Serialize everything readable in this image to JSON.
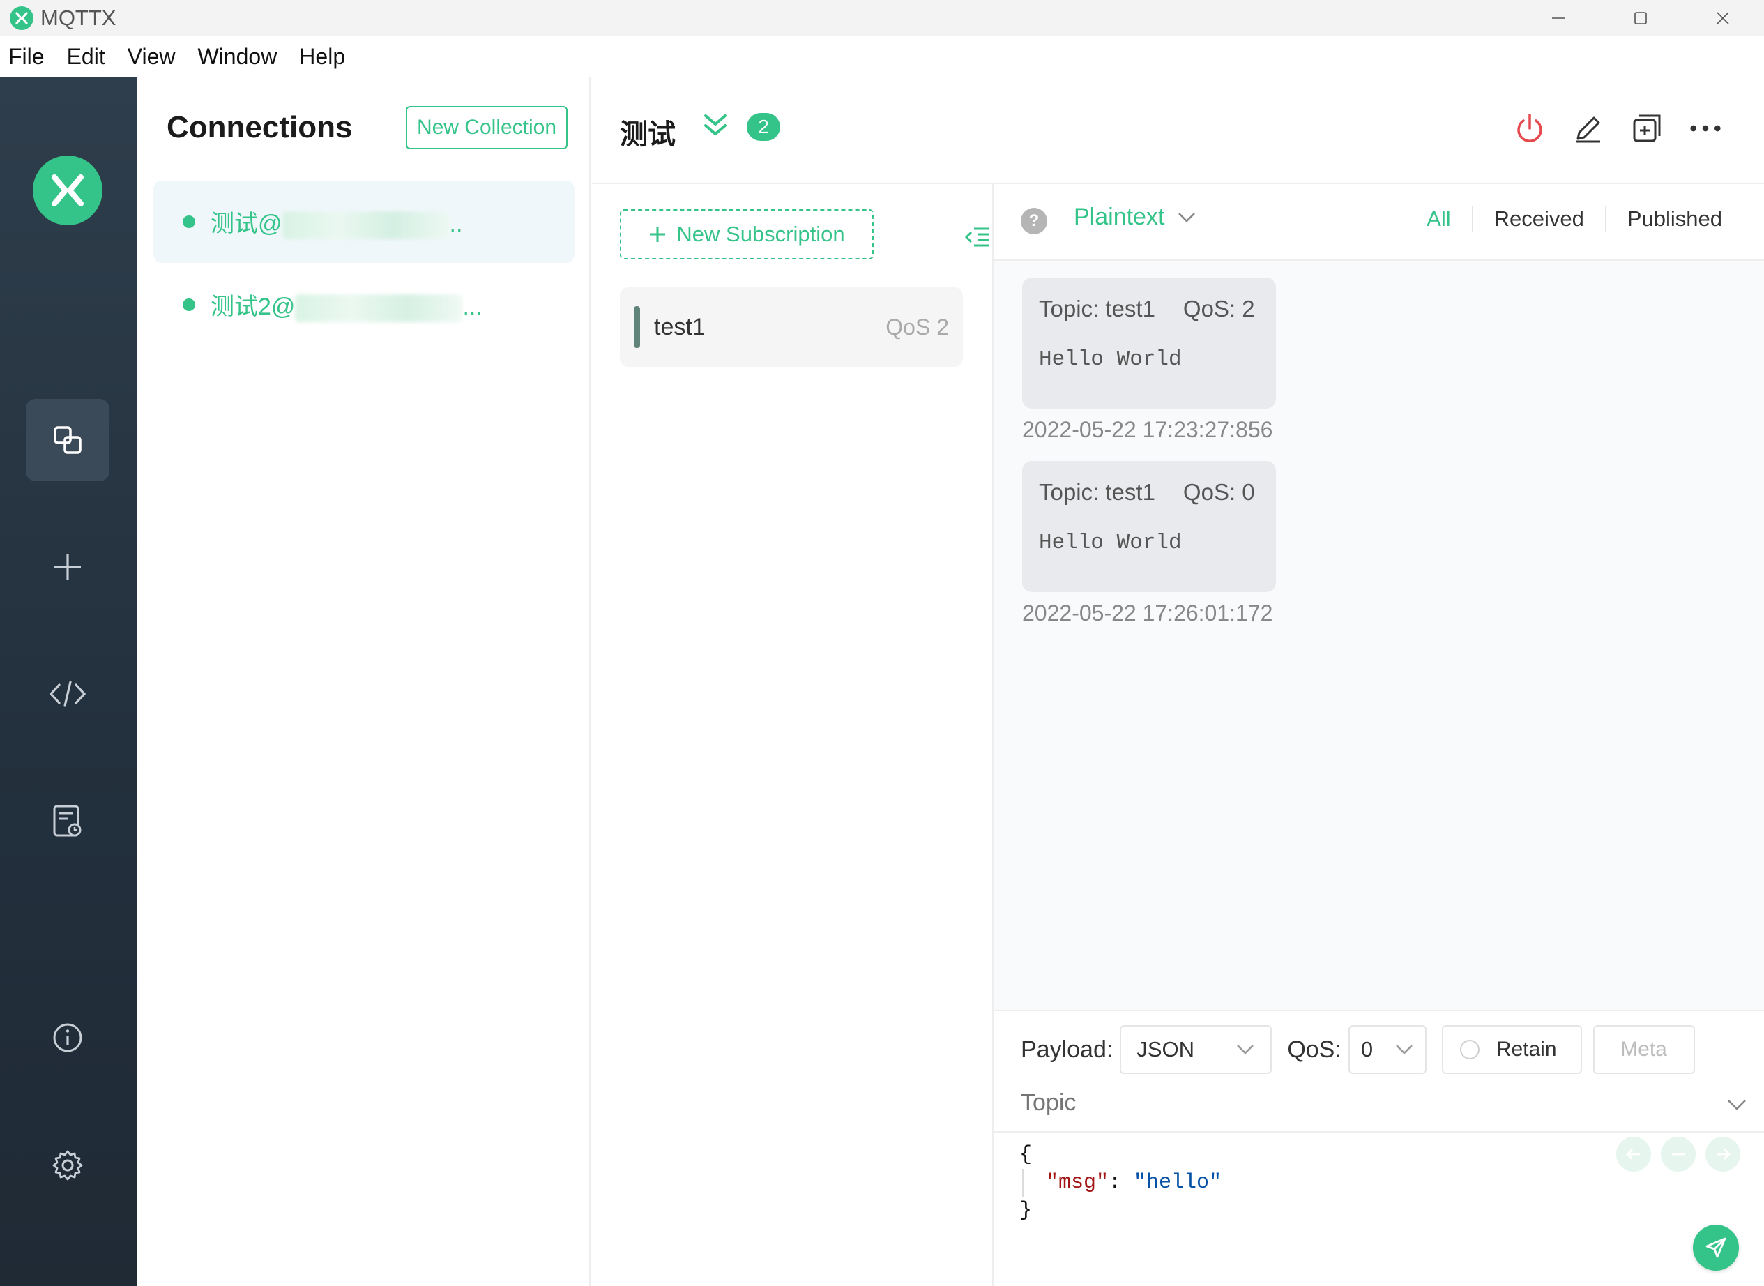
{
  "window": {
    "app_title": "MQTTX"
  },
  "menu": [
    "File",
    "Edit",
    "View",
    "Window",
    "Help"
  ],
  "connections_panel": {
    "title": "Connections",
    "new_collection_label": "New Collection",
    "items": [
      {
        "name_prefix": "测试@",
        "name_suffix": "..",
        "status_color": "#34c388"
      },
      {
        "name_prefix": "测试2@",
        "name_suffix": "...",
        "status_color": "#34c388"
      }
    ]
  },
  "main_header": {
    "title": "测试",
    "badge_count": "2"
  },
  "subscriptions": {
    "new_subscription_label": "New Subscription",
    "items": [
      {
        "topic": "test1",
        "qos": "QoS 2",
        "color": "#60837a"
      }
    ]
  },
  "messages": {
    "format": "Plaintext",
    "filters": [
      "All",
      "Received",
      "Published"
    ],
    "active_filter": "All",
    "list": [
      {
        "topic": "Topic: test1",
        "qos": "QoS: 2",
        "payload": "Hello World",
        "time": "2022-05-22 17:23:27:856"
      },
      {
        "topic": "Topic: test1",
        "qos": "QoS: 0",
        "payload": "Hello World",
        "time": "2022-05-22 17:26:01:172"
      }
    ]
  },
  "publish": {
    "payload_label": "Payload:",
    "payload_format": "JSON",
    "qos_label": "QoS:",
    "qos_value": "0",
    "retain_label": "Retain",
    "meta_label": "Meta",
    "topic_placeholder": "Topic",
    "editor": {
      "open": "{",
      "key": "\"msg\"",
      "colon": ": ",
      "value": "\"hello\"",
      "close": "}"
    }
  },
  "colors": {
    "accent": "#34c388",
    "rail_bg": "#2a3845",
    "danger": "#e5484d"
  }
}
